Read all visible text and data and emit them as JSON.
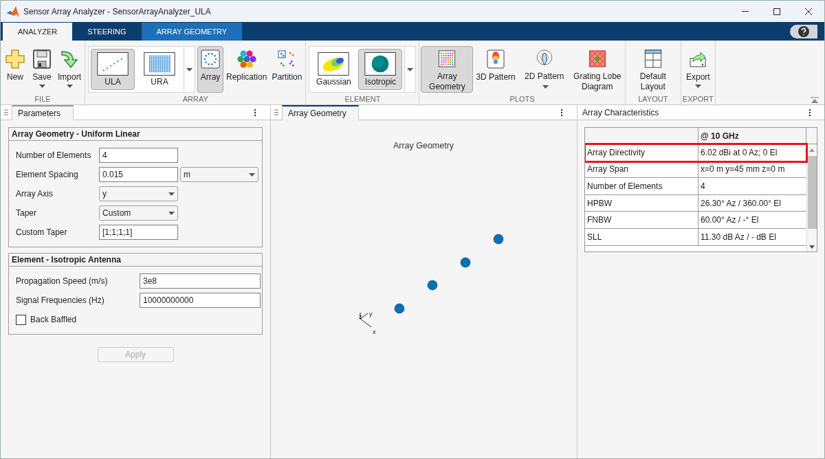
{
  "window": {
    "title": "Sensor Array Analyzer - SensorArrayAnalyzer_ULA"
  },
  "tabs": [
    {
      "label": "ANALYZER",
      "selected": true,
      "kind": "standard"
    },
    {
      "label": "STEERING",
      "selected": false,
      "kind": "standard"
    },
    {
      "label": "ARRAY GEOMETRY",
      "selected": false,
      "kind": "contextual"
    }
  ],
  "ribbon": [
    {
      "label": "FILE",
      "items": [
        {
          "kind": "button",
          "label": "New"
        },
        {
          "kind": "dropdown",
          "label": "Save"
        },
        {
          "kind": "dropdown",
          "label": "Import"
        }
      ]
    },
    {
      "label": "ARRAY",
      "items": [
        {
          "kind": "gallery",
          "options": [
            {
              "label": "ULA",
              "selected": true
            },
            {
              "label": "URA",
              "selected": false
            }
          ]
        },
        {
          "kind": "toggle",
          "label": "Array",
          "selected": true
        },
        {
          "kind": "toggle",
          "label": "Replication",
          "selected": false
        },
        {
          "kind": "toggle",
          "label": "Partition",
          "selected": false
        }
      ]
    },
    {
      "label": "ELEMENT",
      "items": [
        {
          "kind": "gallery",
          "options": [
            {
              "label": "Gaussian",
              "selected": false
            },
            {
              "label": "Isotropic",
              "selected": true
            }
          ]
        }
      ]
    },
    {
      "label": "PLOTS",
      "items": [
        {
          "kind": "toggle",
          "label": "Array Geometry",
          "selected": true
        },
        {
          "kind": "toggle",
          "label": "3D Pattern",
          "selected": false
        },
        {
          "kind": "inline-dropdown",
          "label": "2D Pattern"
        },
        {
          "kind": "toggle",
          "label": "Grating Lobe Diagram",
          "selected": false
        }
      ]
    },
    {
      "label": "LAYOUT",
      "items": [
        {
          "kind": "button",
          "label": "Default Layout"
        }
      ]
    },
    {
      "label": "EXPORT",
      "items": [
        {
          "kind": "dropdown",
          "label": "Export"
        }
      ]
    }
  ],
  "parameters": {
    "tab": "Parameters",
    "groups": [
      {
        "title": "Array Geometry - Uniform Linear",
        "fields": [
          {
            "kind": "text",
            "label": "Number of Elements",
            "value": "4"
          },
          {
            "kind": "text",
            "label": "Element Spacing",
            "value": "0.015",
            "unit": "m"
          },
          {
            "kind": "select",
            "label": "Array Axis",
            "value": "y"
          },
          {
            "kind": "select",
            "label": "Taper",
            "value": "Custom"
          },
          {
            "kind": "text",
            "label": "Custom Taper",
            "value": "[1;1;1;1]"
          }
        ]
      },
      {
        "title": "Element - Isotropic Antenna",
        "fields": [
          {
            "kind": "text",
            "label": "Propagation Speed (m/s)",
            "value": "3e8"
          },
          {
            "kind": "text",
            "label": "Signal Frequencies (Hz)",
            "value": "10000000000"
          },
          {
            "kind": "checkbox",
            "label": "Back Baffled",
            "checked": false
          }
        ]
      }
    ],
    "apply": {
      "label": "Apply",
      "disabled": true
    }
  },
  "plot": {
    "tab": "Array Geometry",
    "tab_selected": true,
    "title": "Array Geometry",
    "axis_labels": {
      "z": "z",
      "y": "y",
      "x": "x"
    }
  },
  "characteristics": {
    "title": "Array Characteristics",
    "header": "@ 10 GHz",
    "rows": [
      {
        "label": "Array Directivity",
        "value": "6.02 dBi at 0 Az; 0 El",
        "highlighted": true
      },
      {
        "label": "Array Span",
        "value": "x=0 m y=45 mm z=0 m",
        "highlighted": false
      },
      {
        "label": "Number of Elements",
        "value": "4",
        "highlighted": false
      },
      {
        "label": "HPBW",
        "value": "26.30° Az / 360.00° El",
        "highlighted": false
      },
      {
        "label": "FNBW",
        "value": "60.00° Az / -° El",
        "highlighted": false
      },
      {
        "label": "SLL",
        "value": "11.30 dB Az / - dB El",
        "highlighted": false
      }
    ]
  }
}
